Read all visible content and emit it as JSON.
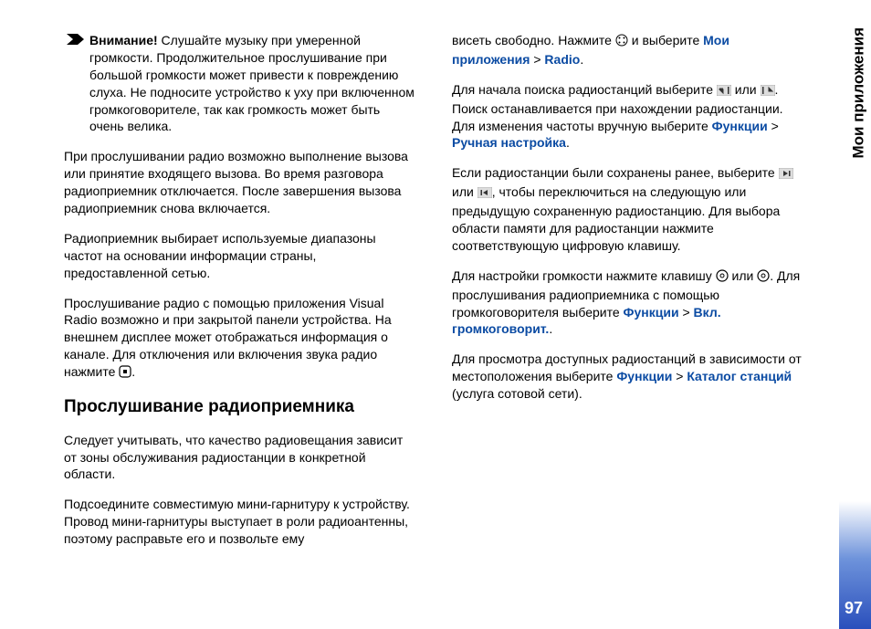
{
  "sideLabel": "Мои приложения",
  "pageNumber": "97",
  "left": {
    "warningBold": "Внимание!",
    "warningText": " Слушайте музыку при умеренной громкости. Продолжительное прослушивание при большой громкости может привести к повреждению слуха. Не подносите устройство к уху при включенном громкоговорителе, так как громкость может быть очень велика.",
    "p2": "При прослушивании радио возможно выполнение вызова или принятие входящего вызова. Во время разговора радиоприемник отключается. После завершения вызова радиоприемник снова включается.",
    "p3": "Радиоприемник выбирает используемые диапазоны частот на основании информации страны, предоставленной сетью.",
    "p4a": "Прослушивание радио с помощью приложения Visual Radio возможно и при закрытой панели устройства. На внешнем дисплее может отображаться информация о канале. Для отключения или включения звука радио нажмите ",
    "p4b": ".",
    "h2": "Прослушивание радиоприемника",
    "p5": "Следует учитывать, что качество радиовещания зависит от зоны обслуживания радиостанции в конкретной области.",
    "p6": "Подсоедините совместимую мини-гарнитуру к устройству. Провод мини-гарнитуры выступает в роли радиоантенны, поэтому расправьте его и позвольте ему"
  },
  "right": {
    "p1a": "висеть свободно. Нажмите ",
    "p1b": " и выберите ",
    "p1link1": "Мои приложения",
    "p1sep": " > ",
    "p1link2": "Radio",
    "p1c": ".",
    "p2a": "Для начала поиска радиостанций выберите ",
    "p2b": " или ",
    "p2c": ". Поиск останавливается при нахождении радиостанции. Для изменения частоты вручную выберите ",
    "p2link1": "Функции",
    "p2sep": " > ",
    "p2link2": "Ручная настройка",
    "p2d": ".",
    "p3a": "Если радиостанции были сохранены ранее, выберите ",
    "p3b": " или ",
    "p3c": ", чтобы переключиться на следующую или предыдущую сохраненную радиостанцию. Для выбора области памяти для радиостанции нажмите соответствующую цифровую клавишу.",
    "p4a": "Для настройки громкости нажмите клавишу ",
    "p4b": " или ",
    "p4c": ". Для прослушивания радиоприемника с помощью громкоговорителя выберите ",
    "p4link1": "Функции",
    "p4sep": " > ",
    "p4link2": "Вкл. громкоговорит.",
    "p4d": ".",
    "p5a": "Для просмотра доступных радиостанций в зависимости от местоположения выберите ",
    "p5link1": "Функции",
    "p5sep": " > ",
    "p5link2": "Каталог станций",
    "p5b": " (услуга сотовой сети)."
  }
}
